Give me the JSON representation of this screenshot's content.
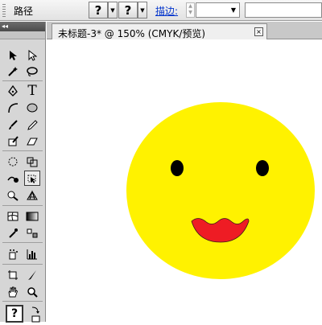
{
  "control_bar": {
    "path_label": "路径",
    "help_glyph_1": "?",
    "help_glyph_2": "?",
    "stroke_label": "描边:",
    "stroke_value": "",
    "style_value": ""
  },
  "document": {
    "tab_title": "未标题-3* @ 150% (CMYK/预览)",
    "close_glyph": "×"
  },
  "tools": {
    "panel_arrows": "◂◂",
    "text_tool_glyph": "T",
    "help_tool_glyph": "?"
  },
  "colors": {
    "face": "#fff200",
    "mouth": "#ee1c24",
    "eye": "#000000",
    "stroke_link": "#0033cc"
  },
  "artwork": {
    "subject": "smiley-face",
    "eyes": 2
  }
}
